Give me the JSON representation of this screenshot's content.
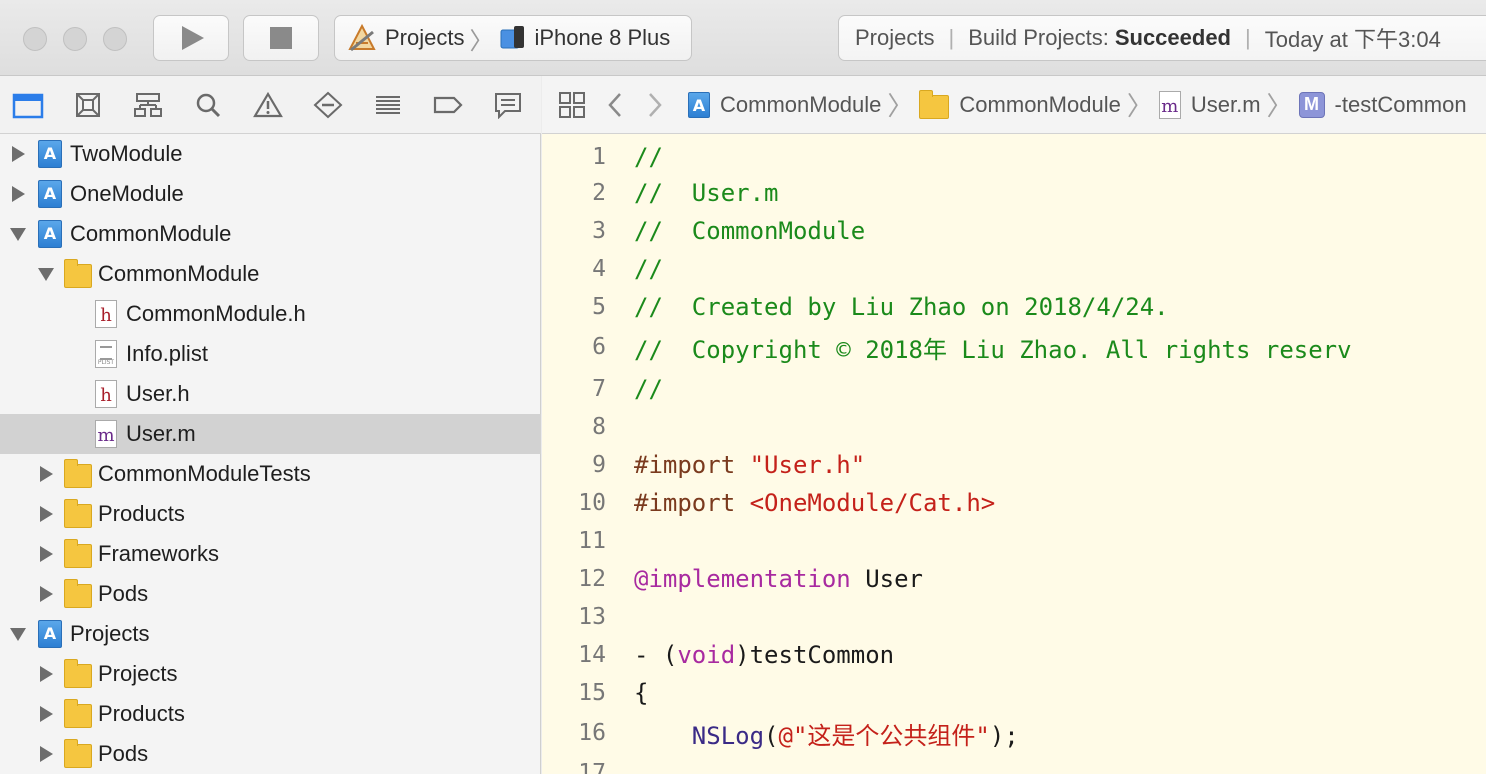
{
  "toolbar": {
    "scheme_project": "Projects",
    "scheme_device": "iPhone 8 Plus",
    "status_project": "Projects",
    "status_build_prefix": "Build Projects:",
    "status_build_result": "Succeeded",
    "status_time": "Today at 下午3:04"
  },
  "navigator": {
    "tabs": [
      "folder-icon",
      "source-control-icon",
      "hierarchy-icon",
      "search-icon",
      "warning-icon",
      "test-icon",
      "debug-icon",
      "breakpoint-icon",
      "report-icon"
    ],
    "tree": [
      {
        "label": "TwoModule",
        "icon": "project",
        "disclosure": "collapsed",
        "indent": 0
      },
      {
        "label": "OneModule",
        "icon": "project",
        "disclosure": "collapsed",
        "indent": 0
      },
      {
        "label": "CommonModule",
        "icon": "project",
        "disclosure": "expanded",
        "indent": 0
      },
      {
        "label": "CommonModule",
        "icon": "folder",
        "disclosure": "expanded",
        "indent": 1
      },
      {
        "label": "CommonModule.h",
        "icon": "h",
        "disclosure": "none",
        "indent": 2
      },
      {
        "label": "Info.plist",
        "icon": "plist",
        "disclosure": "none",
        "indent": 2
      },
      {
        "label": "User.h",
        "icon": "h",
        "disclosure": "none",
        "indent": 2
      },
      {
        "label": "User.m",
        "icon": "m",
        "disclosure": "none",
        "indent": 2,
        "selected": true
      },
      {
        "label": "CommonModuleTests",
        "icon": "folder",
        "disclosure": "collapsed",
        "indent": 1
      },
      {
        "label": "Products",
        "icon": "folder",
        "disclosure": "collapsed",
        "indent": 1
      },
      {
        "label": "Frameworks",
        "icon": "folder",
        "disclosure": "collapsed",
        "indent": 1
      },
      {
        "label": "Pods",
        "icon": "folder",
        "disclosure": "collapsed",
        "indent": 1
      },
      {
        "label": "Projects",
        "icon": "project",
        "disclosure": "expanded",
        "indent": 0
      },
      {
        "label": "Projects",
        "icon": "folder",
        "disclosure": "collapsed",
        "indent": 1
      },
      {
        "label": "Products",
        "icon": "folder",
        "disclosure": "collapsed",
        "indent": 1
      },
      {
        "label": "Pods",
        "icon": "folder",
        "disclosure": "collapsed",
        "indent": 1
      }
    ]
  },
  "jumpbar": {
    "project": "CommonModule",
    "group": "CommonModule",
    "file_badge": "m",
    "file": "User.m",
    "method_badge": "M",
    "method": "-testCommon"
  },
  "editor": {
    "lines": [
      {
        "n": "1",
        "tokens": [
          {
            "t": "//",
            "c": "comment"
          }
        ]
      },
      {
        "n": "2",
        "tokens": [
          {
            "t": "//  User.m",
            "c": "comment"
          }
        ]
      },
      {
        "n": "3",
        "tokens": [
          {
            "t": "//  CommonModule",
            "c": "comment"
          }
        ]
      },
      {
        "n": "4",
        "tokens": [
          {
            "t": "//",
            "c": "comment"
          }
        ]
      },
      {
        "n": "5",
        "tokens": [
          {
            "t": "//  Created by Liu Zhao on 2018/4/24.",
            "c": "comment"
          }
        ]
      },
      {
        "n": "6",
        "tokens": [
          {
            "t": "//  Copyright © 2018年 Liu Zhao. All rights reserv",
            "c": "comment"
          }
        ]
      },
      {
        "n": "7",
        "tokens": [
          {
            "t": "//",
            "c": "comment"
          }
        ]
      },
      {
        "n": "8",
        "tokens": []
      },
      {
        "n": "9",
        "tokens": [
          {
            "t": "#import ",
            "c": "prep"
          },
          {
            "t": "\"User.h\"",
            "c": "str"
          }
        ]
      },
      {
        "n": "10",
        "tokens": [
          {
            "t": "#import ",
            "c": "prep"
          },
          {
            "t": "<OneModule/Cat.h>",
            "c": "str"
          }
        ]
      },
      {
        "n": "11",
        "tokens": []
      },
      {
        "n": "12",
        "tokens": [
          {
            "t": "@implementation",
            "c": "kw"
          },
          {
            "t": " User",
            "c": "plain"
          }
        ]
      },
      {
        "n": "13",
        "tokens": []
      },
      {
        "n": "14",
        "tokens": [
          {
            "t": "- (",
            "c": "plain"
          },
          {
            "t": "void",
            "c": "kw"
          },
          {
            "t": ")testCommon",
            "c": "plain"
          }
        ]
      },
      {
        "n": "15",
        "tokens": [
          {
            "t": "{",
            "c": "plain"
          }
        ]
      },
      {
        "n": "16",
        "tokens": [
          {
            "t": "    ",
            "c": "plain"
          },
          {
            "t": "NSLog",
            "c": "fn"
          },
          {
            "t": "(",
            "c": "plain"
          },
          {
            "t": "@\"这是个公共组件\"",
            "c": "str"
          },
          {
            "t": ");",
            "c": "plain"
          }
        ]
      },
      {
        "n": "17",
        "tokens": []
      }
    ]
  },
  "colors": {
    "editor_bg": "#fffbe7",
    "comment": "#1b8a1b",
    "string": "#c4211a",
    "keyword": "#a82aa0",
    "preprocessor": "#7a3a1e",
    "selection": "#d2d2d2"
  }
}
